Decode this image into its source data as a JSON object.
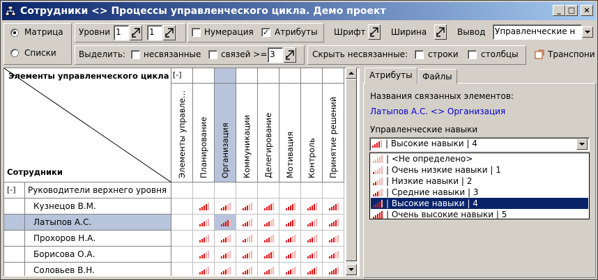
{
  "window": {
    "title": "Сотрудники <> Процессы управленческого цикла. Демо проект",
    "min_icon": "minimize-icon",
    "max_icon": "maximize-icon",
    "close_icon": "close-icon"
  },
  "toolbar": {
    "view_matrix": "Матрица",
    "view_lists": "Списки",
    "view_selected": "Матрица",
    "levels_label": "Уровни",
    "levels_value_1": "1",
    "levels_value_2": "1",
    "numbering_label": "Нумерация",
    "numbering_checked": false,
    "attributes_label": "Атрибуты",
    "attributes_checked": true,
    "font_label": "Шрифт",
    "width_label": "Ширина",
    "output_label": "Вывод",
    "output_value": "Управленческие н",
    "highlight_label": "Выделить:",
    "unlinked_label": "несвязанные",
    "unlinked_checked": false,
    "links_label": "связей >=",
    "links_checked": false,
    "links_value": "3",
    "hide_label": "Скрыть несвязанные:",
    "rows_label": "строки",
    "rows_checked": false,
    "cols_label": "столбцы",
    "cols_checked": false,
    "transpose_label": "Транспони"
  },
  "matrix": {
    "corner_top": "Элементы управленческого цикла ...",
    "corner_bottom": "Сотрудники",
    "header_expander": "[-]",
    "columns": [
      "Элементы управле...",
      "Планирование",
      "Организация",
      "Коммуникации",
      "Делегирование",
      "Мотивация",
      "Контроль",
      "Принятие решений"
    ],
    "selected_column": 2,
    "selected_row": 2,
    "group_expander": "[-]",
    "group_name": "Руководители верхнего уровня",
    "rows": [
      {
        "name": "Кузнецов В.М.",
        "levels": [
          null,
          4,
          3,
          3,
          4,
          4,
          4,
          4
        ]
      },
      {
        "name": "Латыпов А.С.",
        "levels": [
          null,
          3,
          4,
          3,
          3,
          4,
          3,
          4
        ]
      },
      {
        "name": "Прохоров Н.А.",
        "levels": [
          null,
          3,
          3,
          2,
          3,
          3,
          3,
          3
        ]
      },
      {
        "name": "Борисова О.А.",
        "levels": [
          null,
          3,
          3,
          3,
          4,
          3,
          3,
          3
        ]
      },
      {
        "name": "Соловьев В.Н.",
        "levels": [
          null,
          3,
          3,
          3,
          3,
          3,
          4,
          4
        ]
      }
    ]
  },
  "panel": {
    "tabs": [
      "Атрибуты",
      "Файлы"
    ],
    "active_tab": "Атрибуты",
    "linked_names_label": "Названия связанных элементов:",
    "linked_names_value": "Латыпов А.С. <> Организация",
    "skills_label": "Управленческие навыки",
    "skills_value": "| Высокие навыки | 4",
    "skills_value_level": 4,
    "options": [
      {
        "label": "| <Не определено>",
        "level": 0
      },
      {
        "label": "| Очень низкие навыки | 1",
        "level": 1
      },
      {
        "label": "| Низкие навыки | 2",
        "level": 2
      },
      {
        "label": "| Средние навыки | 3",
        "level": 3
      },
      {
        "label": "| Высокие навыки | 4",
        "level": 4
      },
      {
        "label": "| Очень высокие навыки | 5",
        "level": 5
      }
    ],
    "highlighted_option": 4
  },
  "colors": {
    "bar_on": "#e01010",
    "bar_off": "#f4b0b0",
    "selection": "#b8c4dc",
    "highlight": "#0a246a",
    "link_blue": "#0000cc"
  }
}
